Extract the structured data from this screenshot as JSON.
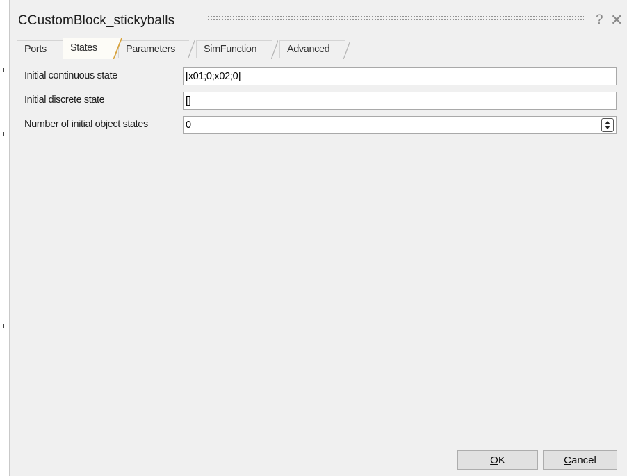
{
  "window": {
    "title": "CCustomBlock_stickyballs",
    "help_glyph": "?",
    "close_glyph": "✕"
  },
  "tabs": [
    {
      "label": "Ports",
      "active": false
    },
    {
      "label": "States",
      "active": true
    },
    {
      "label": "Parameters",
      "active": false
    },
    {
      "label": "SimFunction",
      "active": false
    },
    {
      "label": "Advanced",
      "active": false
    }
  ],
  "fields": [
    {
      "label": "Initial continuous state",
      "value": "[x01;0;x02;0]"
    },
    {
      "label": "Initial discrete state",
      "value": "[]"
    },
    {
      "label": "Number of initial object states",
      "value": "0"
    }
  ],
  "buttons": {
    "ok": {
      "mnemonic": "O",
      "rest": "K"
    },
    "cancel": {
      "mnemonic": "C",
      "rest": "ancel"
    }
  },
  "colors": {
    "active_tab_border": "#e8c060",
    "dialog_bg": "#f0f0f0"
  }
}
